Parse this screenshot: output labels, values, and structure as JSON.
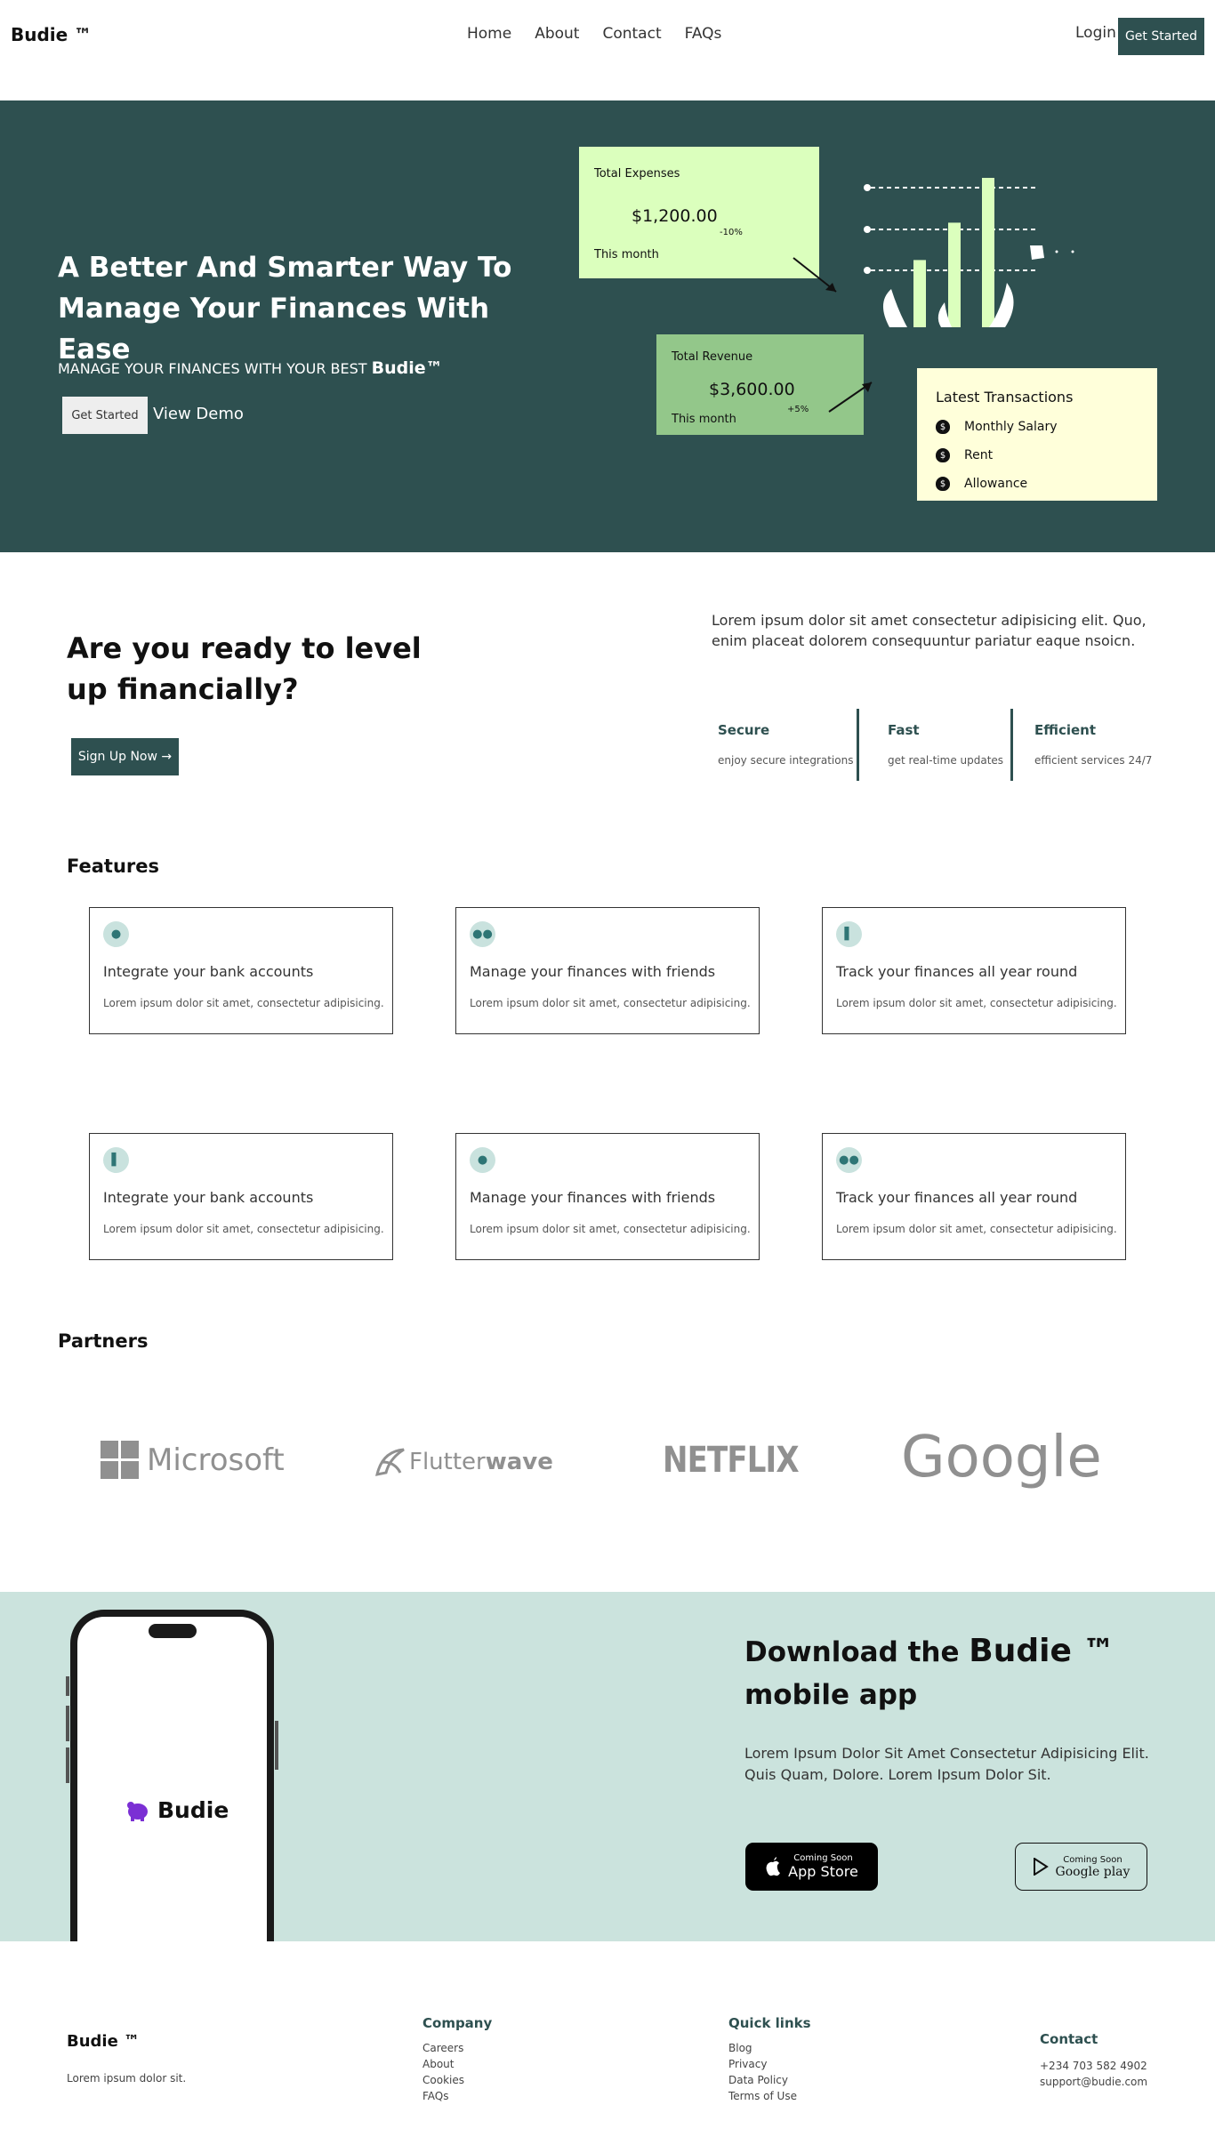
{
  "nav": {
    "brand": "Budie ™",
    "links": [
      "Home",
      "About",
      "Contact",
      "FAQs"
    ],
    "login": "Login",
    "cta": "Get Started"
  },
  "hero": {
    "title": "A Better And Smarter Way To Manage Your Finances With Ease",
    "subtitle_prefix": "MANAGE YOUR FINANCES WITH YOUR BEST",
    "subtitle_brand": "Budie™",
    "primary_button": "Get Started",
    "secondary_button": "View Demo",
    "expenses_card": {
      "label": "Total Expenses",
      "amount": "$1,200.00",
      "change": "-10%",
      "period": "This month"
    },
    "revenue_card": {
      "label": "Total Revenue",
      "amount": "$3,600.00",
      "change": "+5%",
      "period": "This month"
    },
    "transactions": {
      "title": "Latest Transactions",
      "items": [
        "Monthly Salary",
        "Rent",
        "Allowance"
      ]
    },
    "chart_bar_levels": [
      0.45,
      0.7,
      1.0
    ]
  },
  "levelup": {
    "title": "Are you ready to level up financially?",
    "button": "Sign Up Now →",
    "description": "Lorem ipsum dolor sit amet consectetur adipisicing elit. Quo, enim placeat dolorem consequuntur pariatur eaque nsoicn.",
    "stats": [
      {
        "title": "Secure",
        "text": "enjoy secure integrations"
      },
      {
        "title": "Fast",
        "text": "get real-time updates"
      },
      {
        "title": "Efficient",
        "text": "efficient services 24/7"
      }
    ]
  },
  "features": {
    "heading": "Features",
    "cards": [
      {
        "icon": "piggy-bank-icon",
        "title": "Integrate your bank accounts",
        "text": "Lorem ipsum dolor sit amet, consectetur adipisicing."
      },
      {
        "icon": "users-icon",
        "title": "Manage your finances with friends",
        "text": "Lorem ipsum dolor sit amet, consectetur adipisicing."
      },
      {
        "icon": "bar-chart-icon",
        "title": "Track your finances all year round",
        "text": "Lorem ipsum dolor sit amet, consectetur adipisicing."
      },
      {
        "icon": "bar-chart-icon",
        "title": "Integrate your bank accounts",
        "text": "Lorem ipsum dolor sit amet, consectetur adipisicing."
      },
      {
        "icon": "piggy-bank-icon",
        "title": "Manage your finances with friends",
        "text": "Lorem ipsum dolor sit amet, consectetur adipisicing."
      },
      {
        "icon": "users-icon",
        "title": "Track your finances all year round",
        "text": "Lorem ipsum dolor sit amet, consectetur adipisicing."
      }
    ]
  },
  "partners": {
    "heading": "Partners",
    "logos": [
      "Microsoft",
      "Flutter",
      "wave",
      "NETFLIX",
      "Google"
    ]
  },
  "app": {
    "heading_prefix": "Download the",
    "heading_brand": "Budie ™",
    "heading_suffix": "mobile app",
    "description": "Lorem Ipsum Dolor Sit Amet Consectetur Adipisicing Elit. Quis Quam, Dolore. Lorem Ipsum Dolor Sit.",
    "phone_brand": "Budie",
    "app_store": {
      "small": "Coming Soon",
      "big": "App Store"
    },
    "google_play": {
      "small": "Coming Soon",
      "big": "Google play"
    }
  },
  "footer": {
    "brand": "Budie ™",
    "tagline": "Lorem ipsum dolor sit.",
    "company": {
      "heading": "Company",
      "links": [
        "Careers",
        "About",
        "Cookies",
        "FAQs"
      ]
    },
    "quick": {
      "heading": "Quick links",
      "links": [
        "Blog",
        "Privacy",
        "Data Policy",
        "Terms of Use"
      ]
    },
    "contact": {
      "heading": "Contact",
      "phone": "+234 703 582 4902",
      "email": "support@budie.com"
    }
  },
  "colors": {
    "primary": "#2e5050",
    "light_green": "#dbffbd",
    "mid_green": "#93c78a",
    "cream": "#ffffda",
    "mint": "#cbe3dd"
  }
}
